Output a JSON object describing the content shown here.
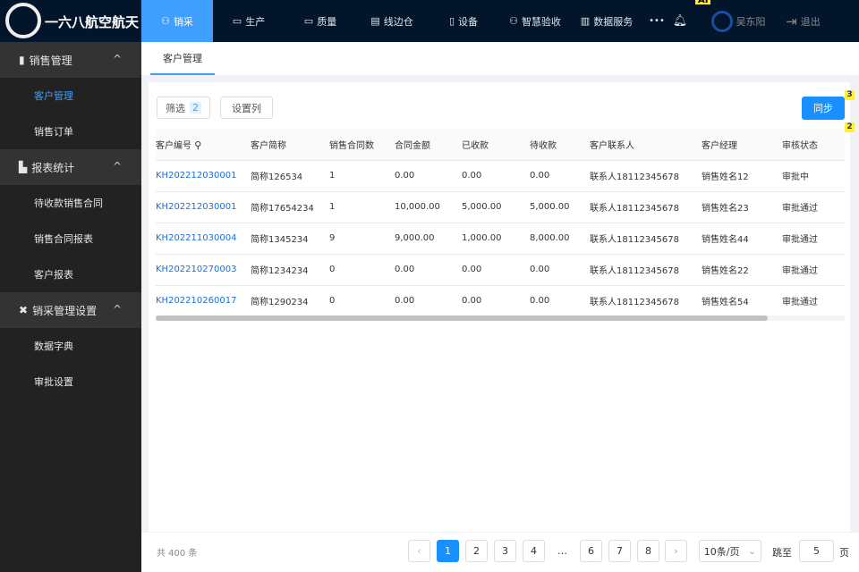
{
  "header": {
    "brand": "一六八航空航天",
    "nav": [
      {
        "label": "销采",
        "icon": "user-icon"
      },
      {
        "label": "生产",
        "icon": "laptop-icon"
      },
      {
        "label": "质量",
        "icon": "laptop-icon"
      },
      {
        "label": "线边仓",
        "icon": "file-icon"
      },
      {
        "label": "设备",
        "icon": "book-icon"
      },
      {
        "label": "智慧验收",
        "icon": "person-icon"
      },
      {
        "label": "数据服务",
        "icon": "chart-icon"
      }
    ],
    "more": "•••",
    "ai_badge": "AI",
    "user": "吴东阳",
    "logout": "退出",
    "accent": "#409eff",
    "bg": "#02152b"
  },
  "sidebar": {
    "groups": [
      {
        "label": "销售管理",
        "items": [
          "客户管理",
          "销售订单"
        ]
      },
      {
        "label": "报表统计",
        "items": [
          "待收款销售合同",
          "销售合同报表",
          "客户报表"
        ]
      },
      {
        "label": "销采管理设置",
        "items": [
          "数据字典",
          "审批设置"
        ]
      }
    ],
    "active": "客户管理"
  },
  "tab": "客户管理",
  "toolbar": {
    "filter": "筛选",
    "filter_count": "2",
    "columns": "设置列",
    "sync": "同步",
    "badge_sync": "3",
    "badge_table": "2"
  },
  "table": {
    "headers": [
      "客户编号",
      "客户简称",
      "销售合同数",
      "合同金额",
      "已收款",
      "待收款",
      "客户联系人",
      "客户经理",
      "审核状态"
    ],
    "rows": [
      [
        "KH202212030001",
        "简称126534",
        "1",
        "0.00",
        "0.00",
        "0.00",
        "联系人18112345678",
        "销售姓名12",
        "审批中"
      ],
      [
        "KH202212030001",
        "简称17654234",
        "1",
        "10,000.00",
        "5,000.00",
        "5,000.00",
        "联系人18112345678",
        "销售姓名23",
        "审批通过"
      ],
      [
        "KH202211030004",
        "简称1345234",
        "9",
        "9,000.00",
        "1,000.00",
        "8,000.00",
        "联系人18112345678",
        "销售姓名44",
        "审批通过"
      ],
      [
        "KH202210270003",
        "简称1234234",
        "0",
        "0.00",
        "0.00",
        "0.00",
        "联系人18112345678",
        "销售姓名22",
        "审批通过"
      ],
      [
        "KH202210260017",
        "简称1290234",
        "0",
        "0.00",
        "0.00",
        "0.00",
        "联系人18112345678",
        "销售姓名54",
        "审批通过"
      ]
    ]
  },
  "pagination": {
    "total": "共 400 条",
    "pages": [
      "1",
      "2",
      "3",
      "4",
      "…",
      "6",
      "7",
      "8"
    ],
    "current": "1",
    "page_size": "10条/页",
    "jump_label": "跳至",
    "jump_value": "5",
    "page_unit": "页"
  }
}
